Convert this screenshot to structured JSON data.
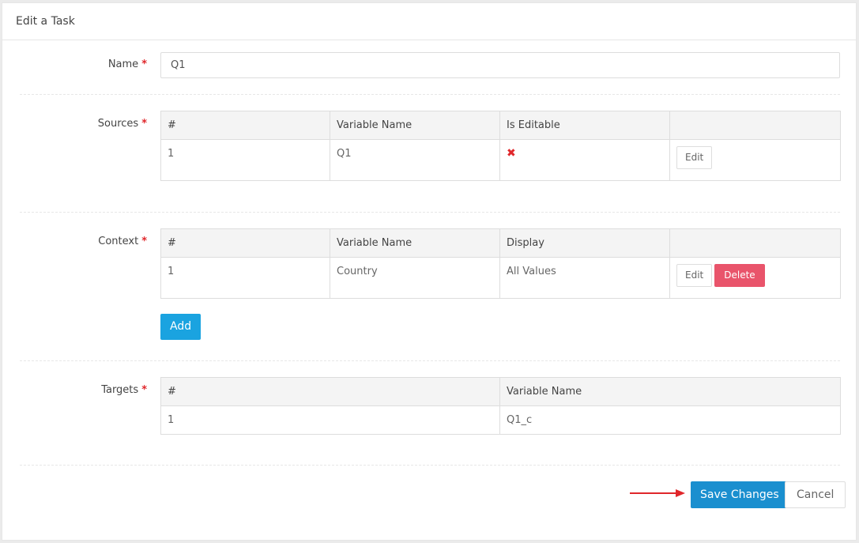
{
  "header": {
    "title": "Edit a Task"
  },
  "required_mark": "*",
  "name_field": {
    "label": "Name",
    "value": "Q1"
  },
  "sources": {
    "label": "Sources",
    "columns": [
      "#",
      "Variable Name",
      "Is Editable",
      ""
    ],
    "rows": [
      {
        "index": "1",
        "variable": "Q1",
        "is_editable_icon": "red-x-icon",
        "edit_label": "Edit"
      }
    ]
  },
  "context": {
    "label": "Context",
    "columns": [
      "#",
      "Variable Name",
      "Display",
      ""
    ],
    "rows": [
      {
        "index": "1",
        "variable": "Country",
        "display": "All Values",
        "edit_label": "Edit",
        "delete_label": "Delete"
      }
    ],
    "add_label": "Add"
  },
  "targets": {
    "label": "Targets",
    "columns": [
      "#",
      "Variable Name"
    ],
    "rows": [
      {
        "index": "1",
        "variable": "Q1_c"
      }
    ]
  },
  "footer": {
    "save_label": "Save Changes",
    "cancel_label": "Cancel"
  },
  "colors": {
    "primary": "#1aa3e0",
    "save": "#1a8fcf",
    "danger": "#e9546b",
    "required": "#e0272b",
    "arrow": "#e0272b"
  }
}
